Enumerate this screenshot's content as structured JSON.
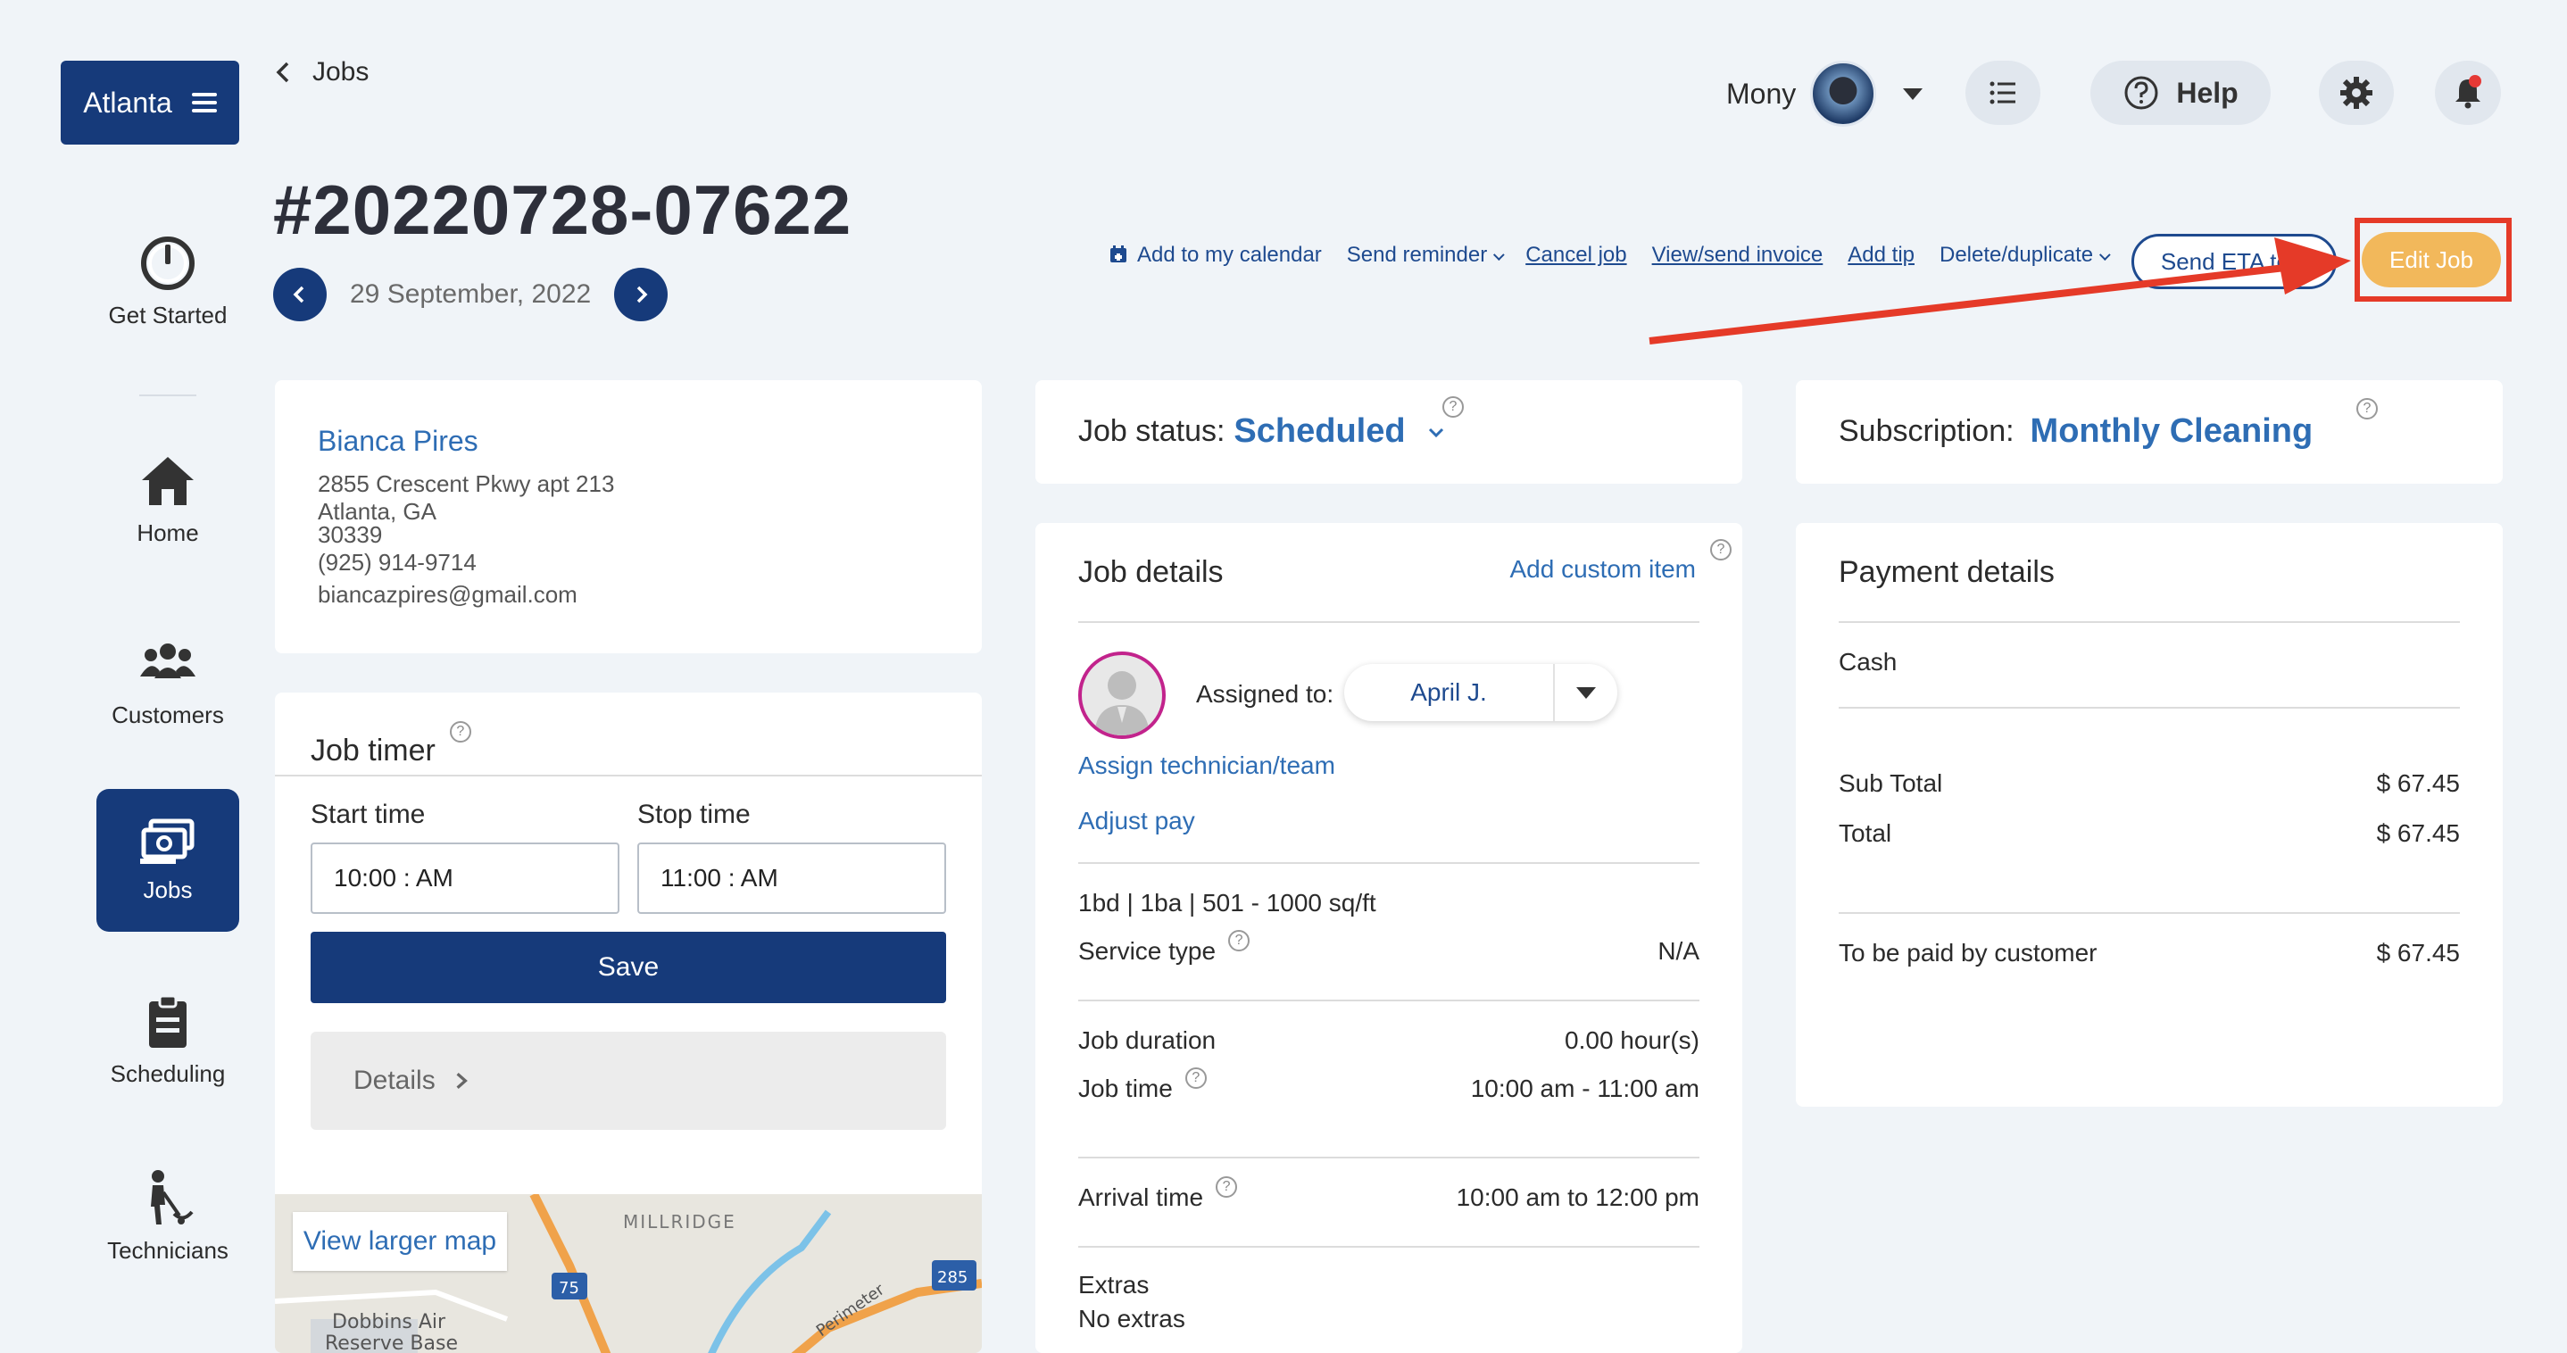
{
  "sidebar": {
    "brand": "Atlanta",
    "items": [
      {
        "label": "Get Started",
        "icon": "power-icon"
      },
      {
        "label": "Home",
        "icon": "home-icon"
      },
      {
        "label": "Customers",
        "icon": "users-icon"
      },
      {
        "label": "Jobs",
        "icon": "jobs-icon",
        "active": true
      },
      {
        "label": "Scheduling",
        "icon": "clipboard-icon"
      },
      {
        "label": "Technicians",
        "icon": "technician-icon"
      }
    ]
  },
  "header": {
    "back_label": "Jobs",
    "job_number": "#20220728-07622",
    "date": "29 September, 2022",
    "user_name": "Mony",
    "help_label": "Help"
  },
  "actions": {
    "add_calendar": "Add to my calendar",
    "send_reminder": "Send reminder",
    "cancel_job": "Cancel job",
    "view_invoice": "View/send invoice",
    "add_tip": "Add tip",
    "delete_duplicate": "Delete/duplicate",
    "send_eta": "Send ETA text",
    "edit_job": "Edit Job"
  },
  "customer": {
    "name": "Bianca Pires",
    "address1": "2855 Crescent Pkwy apt 213",
    "address2": "Atlanta, GA",
    "zip": "30339",
    "phone": "(925) 914-9714",
    "email": "biancazpires@gmail.com"
  },
  "timer": {
    "title": "Job timer",
    "start_label": "Start time",
    "stop_label": "Stop time",
    "start_value": "10:00 : AM",
    "stop_value": "11:00 : AM",
    "save_label": "Save",
    "details_label": "Details",
    "map_button": "View larger map",
    "map_labels": [
      "MILLRIDGE",
      "Dobbins Air",
      "Reserve Base",
      "Perimeter",
      "75",
      "285"
    ]
  },
  "status": {
    "label": "Job status:",
    "value": "Scheduled"
  },
  "subscription": {
    "label": "Subscription:",
    "value": "Monthly Cleaning"
  },
  "job_details": {
    "title": "Job details",
    "add_custom": "Add custom item",
    "assigned_label": "Assigned to:",
    "assigned_name": "April J.",
    "assign_link": "Assign technician/team",
    "adjust_pay": "Adjust pay",
    "rooms": "1bd | 1ba | 501 - 1000 sq/ft",
    "service_type_label": "Service type",
    "service_type_value": "N/A",
    "duration_label": "Job duration",
    "duration_value": "0.00 hour(s)",
    "job_time_label": "Job time",
    "job_time_value": "10:00 am - 11:00 am",
    "arrival_label": "Arrival time",
    "arrival_value": "10:00 am to 12:00 pm",
    "extras_label": "Extras",
    "extras_value": "No extras"
  },
  "payment": {
    "title": "Payment details",
    "method": "Cash",
    "subtotal_label": "Sub Total",
    "subtotal_value": "$ 67.45",
    "total_label": "Total",
    "total_value": "$ 67.45",
    "due_label": "To be paid by customer",
    "due_value": "$ 67.45"
  },
  "colors": {
    "primary": "#163a7a",
    "link": "#2e6db4",
    "accent": "#f2b85b",
    "annotation": "#e53a28"
  }
}
